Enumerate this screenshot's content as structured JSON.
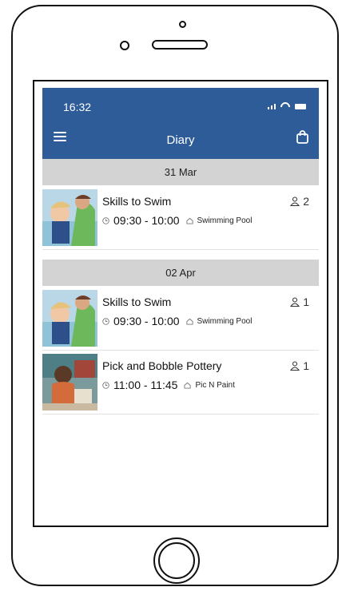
{
  "status_bar": {
    "time": "16:32"
  },
  "header": {
    "title": "Diary"
  },
  "sections": [
    {
      "date": "31 Mar",
      "entries": [
        {
          "title": "Skills to Swim",
          "time": "09:30 - 10:00",
          "location": "Swimming Pool",
          "count": "2",
          "image": "swimming-child-photo"
        }
      ]
    },
    {
      "date": "02 Apr",
      "entries": [
        {
          "title": "Skills to Swim",
          "time": "09:30 - 10:00",
          "location": "Swimming Pool",
          "count": "1",
          "image": "swimming-child-photo"
        },
        {
          "title": "Pick and Bobble Pottery",
          "time": "11:00 - 11:45",
          "location": "Pic N Paint",
          "count": "1",
          "image": "pottery-child-photo"
        }
      ]
    }
  ],
  "colors": {
    "header": "#2e5c98",
    "date_bar": "#d3d3d3",
    "text": "#111111"
  },
  "icons": [
    "menu-icon",
    "shopping-bag-icon",
    "person-icon",
    "clock-icon",
    "location-icon"
  ]
}
